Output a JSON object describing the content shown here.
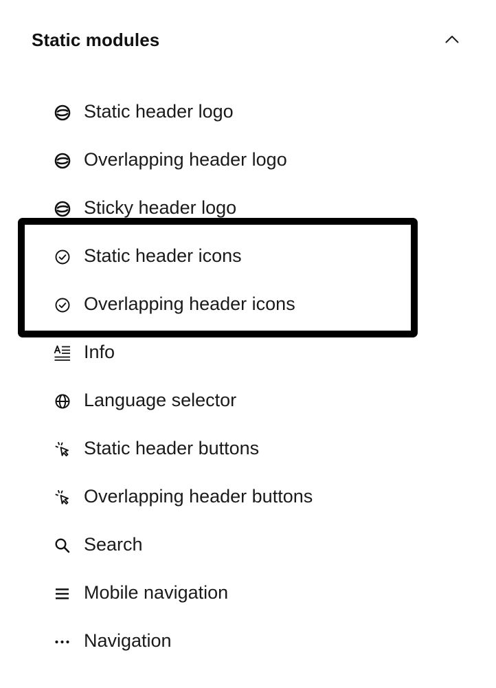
{
  "panel": {
    "title": "Static modules",
    "collapse_icon": "chevron-up-icon"
  },
  "modules": [
    {
      "label": "Static header logo",
      "icon": "logo-icon"
    },
    {
      "label": "Overlapping header logo",
      "icon": "logo-icon"
    },
    {
      "label": "Sticky header logo",
      "icon": "logo-icon"
    },
    {
      "label": "Static header icons",
      "icon": "check-circle-icon"
    },
    {
      "label": "Overlapping header icons",
      "icon": "check-circle-icon"
    },
    {
      "label": "Info",
      "icon": "text-format-icon"
    },
    {
      "label": "Language selector",
      "icon": "globe-icon"
    },
    {
      "label": "Static header buttons",
      "icon": "cursor-click-icon"
    },
    {
      "label": "Overlapping header buttons",
      "icon": "cursor-click-icon"
    },
    {
      "label": "Search",
      "icon": "search-icon"
    },
    {
      "label": "Mobile navigation",
      "icon": "hamburger-menu-icon"
    },
    {
      "label": "Navigation",
      "icon": "more-horizontal-icon"
    }
  ],
  "highlight": {
    "color": "#000000",
    "covers_items": [
      "Static header icons",
      "Overlapping header icons"
    ]
  }
}
